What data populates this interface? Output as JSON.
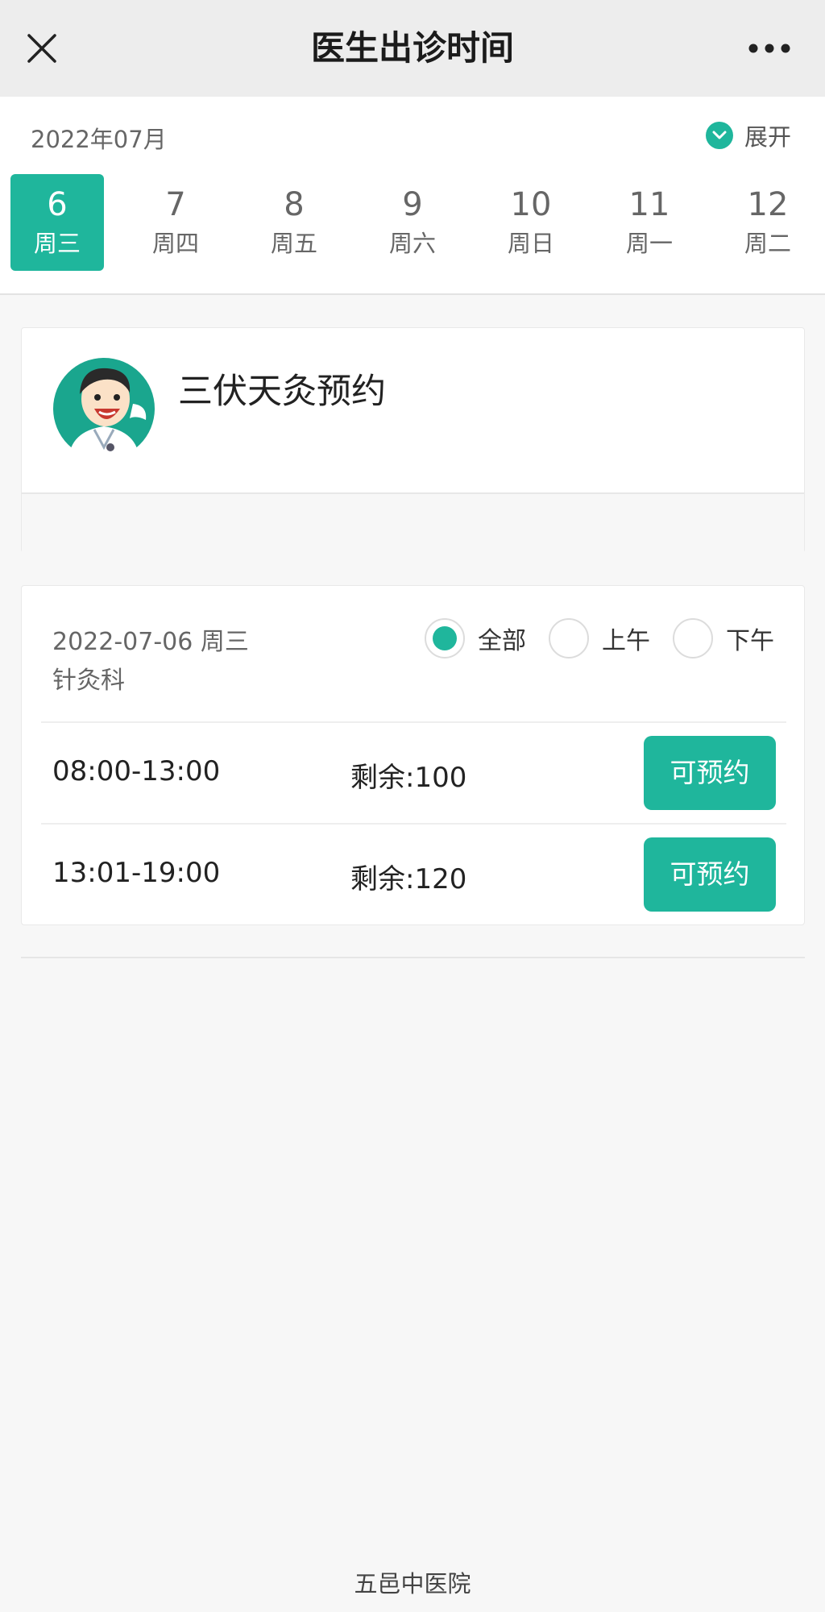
{
  "header": {
    "title": "医生出诊时间",
    "close_icon": "close-icon",
    "more_icon": "more-icon"
  },
  "calendar": {
    "month": "2022年07月",
    "expand_label": "展开",
    "days": [
      {
        "day": "6",
        "weekday": "周三",
        "selected": true
      },
      {
        "day": "7",
        "weekday": "周四",
        "selected": false
      },
      {
        "day": "8",
        "weekday": "周五",
        "selected": false
      },
      {
        "day": "9",
        "weekday": "周六",
        "selected": false
      },
      {
        "day": "10",
        "weekday": "周日",
        "selected": false
      },
      {
        "day": "11",
        "weekday": "周一",
        "selected": false
      },
      {
        "day": "12",
        "weekday": "周二",
        "selected": false
      }
    ]
  },
  "doctor": {
    "name": "三伏天灸预约",
    "avatar_icon": "doctor-avatar"
  },
  "schedule": {
    "date": "2022-07-06 周三",
    "department": "针灸科",
    "filters": [
      {
        "label": "全部",
        "selected": true
      },
      {
        "label": "上午",
        "selected": false
      },
      {
        "label": "下午",
        "selected": false
      }
    ],
    "slots": [
      {
        "time": "08:00-13:00",
        "remaining": "剩余:100",
        "button": "可预约"
      },
      {
        "time": "13:01-19:00",
        "remaining": "剩余:120",
        "button": "可预约"
      }
    ]
  },
  "footer": {
    "hospital": "五邑中医院"
  },
  "colors": {
    "accent": "#1fb69c"
  }
}
